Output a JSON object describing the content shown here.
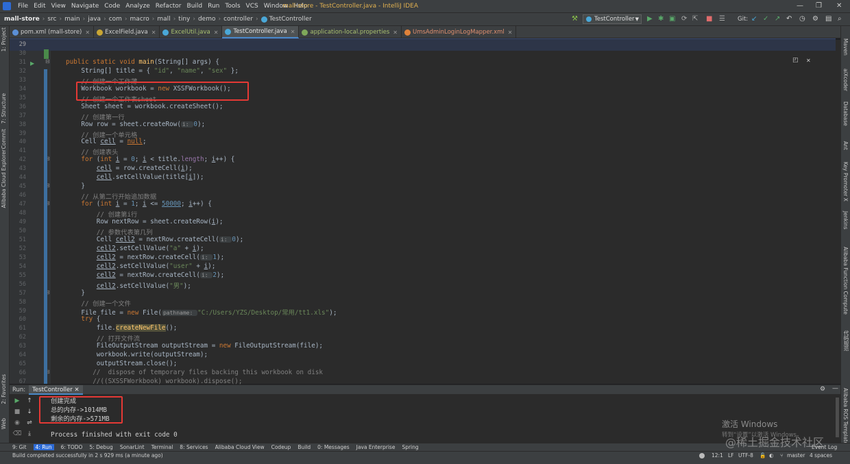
{
  "menubar": {
    "items": [
      "File",
      "Edit",
      "View",
      "Navigate",
      "Code",
      "Analyze",
      "Refactor",
      "Build",
      "Run",
      "Tools",
      "VCS",
      "Window",
      "Help"
    ],
    "window_title": "mall-store - TestController.java - IntelliJ IDEA"
  },
  "breadcrumb": [
    "mall-store",
    "src",
    "main",
    "java",
    "com",
    "macro",
    "mall",
    "tiny",
    "demo",
    "controller",
    "TestController"
  ],
  "toolbar": {
    "run_config": "TestController",
    "git_label": "Git:"
  },
  "tabs": [
    {
      "label": "pom.xml (mall-store)",
      "icon_color": "#5b8fd6"
    },
    {
      "label": "ExcelField.java",
      "icon_color": "#c9a634"
    },
    {
      "label": "ExcelUtil.java",
      "icon_color": "#4aa8d8"
    },
    {
      "label": "TestController.java",
      "icon_color": "#4aa8d8"
    },
    {
      "label": "application-local.properties",
      "icon_color": "#7fa85a"
    },
    {
      "label": "UmsAdminLoginLogMapper.xml",
      "icon_color": "#e0823a"
    }
  ],
  "left_strip": [
    "1: Project",
    "7: Structure",
    "Commit",
    "Alibaba Cloud Explorer",
    "2: Favorites",
    "Web"
  ],
  "right_strip": [
    "Maven",
    "aiXcoder",
    "Database",
    "Ant",
    "Key Promoter X",
    "Jenkins",
    "Alibaba Function Compute",
    "代码规范",
    "Alibaba ROS Templates"
  ],
  "editor": {
    "lines": [
      {
        "n": "29",
        "html": ""
      },
      {
        "n": "30",
        "html": ""
      },
      {
        "n": "31",
        "html": "<span class='kw'>public static void </span><span style='color:#ffc66d'>main</span>(String[] args) {"
      },
      {
        "n": "32",
        "html": "    String[] title = { <span class='str'>\"id\"</span>, <span class='str'>\"name\"</span>, <span class='str'>\"sex\"</span> };"
      },
      {
        "n": "33",
        "html": "    <span class='cm'>// 创建一个工作薄</span>"
      },
      {
        "n": "34",
        "html": "    Workbook workbook = <span class='kw'>new </span>XSSFWorkbook();"
      },
      {
        "n": "35",
        "html": "    <span class='cm'>// 创建一个工作表sheet</span>"
      },
      {
        "n": "36",
        "html": "    Sheet sheet = workbook.createSheet();"
      },
      {
        "n": "37",
        "html": "    <span class='cm'>// 创建第一行</span>"
      },
      {
        "n": "38",
        "html": "    Row row = sheet.createRow(<span class='hint'>i: </span><span class='num'>0</span>);"
      },
      {
        "n": "39",
        "html": "    <span class='cm'>// 创建一个单元格</span>"
      },
      {
        "n": "40",
        "html": "    Cell <span class='u'>cell</span> = <span class='kw u'>null</span>;"
      },
      {
        "n": "41",
        "html": "    <span class='cm'>// 创建表头</span>"
      },
      {
        "n": "42",
        "html": "    <span class='kw'>for </span>(<span class='kw'>int </span><span class='u'>i</span> = <span class='num'>0</span>; <span class='u'>i</span> &lt; title.<span class='fld'>length</span>; <span class='u'>i</span>++) {"
      },
      {
        "n": "43",
        "html": "        <span class='u'>cell</span> = row.createCell(<span class='u'>i</span>);"
      },
      {
        "n": "44",
        "html": "        <span class='u'>cell</span>.setCellValue(title[<span class='u'>i</span>]);"
      },
      {
        "n": "45",
        "html": "    }"
      },
      {
        "n": "46",
        "html": "    <span class='cm'>// 从第二行开始追加数据</span>"
      },
      {
        "n": "47",
        "html": "    <span class='kw'>for </span>(<span class='kw'>int </span><span class='u'>i</span> = <span class='num'>1</span>; <span class='u'>i</span> &lt;= <span class='num u'>50000</span>; <span class='u'>i</span>++) {"
      },
      {
        "n": "48",
        "html": "        <span class='cm'>// 创建第i行</span>"
      },
      {
        "n": "49",
        "html": "        Row nextRow = sheet.createRow(<span class='u'>i</span>);"
      },
      {
        "n": "50",
        "html": "        <span class='cm'>// 参数代表第几列</span>"
      },
      {
        "n": "51",
        "html": "        Cell <span class='u'>cell2</span> = nextRow.createCell(<span class='hint'>i: </span><span class='num'>0</span>);"
      },
      {
        "n": "52",
        "html": "        <span class='u'>cell2</span>.setCellValue(<span class='str'>\"a\"</span> + <span class='u'>i</span>);"
      },
      {
        "n": "53",
        "html": "        <span class='u'>cell2</span> = nextRow.createCell(<span class='hint'>i: </span><span class='num'>1</span>);"
      },
      {
        "n": "54",
        "html": "        <span class='u'>cell2</span>.setCellValue(<span class='str'>\"user\"</span> + <span class='u'>i</span>);"
      },
      {
        "n": "55",
        "html": "        <span class='u'>cell2</span> = nextRow.createCell(<span class='hint'>i: </span><span class='num'>2</span>);"
      },
      {
        "n": "56",
        "html": "        <span class='u'>cell2</span>.setCellValue(<span class='str'>\"男\"</span>);"
      },
      {
        "n": "57",
        "html": "    }"
      },
      {
        "n": "58",
        "html": "    <span class='cm'>// 创建一个文件</span>"
      },
      {
        "n": "59",
        "html": "    File file = <span class='kw'>new </span>File(<span class='hint'>pathname: </span><span class='str'>\"C:/Users/YZS/Desktop/常用/tt1.xls\"</span>);"
      },
      {
        "n": "60",
        "html": "    <span class='kw'>try </span>{"
      },
      {
        "n": "61",
        "html": "        file.<span class='hl'>createNewFile</span>();"
      },
      {
        "n": "62",
        "html": "        <span class='cm'>// 打开文件流</span>"
      },
      {
        "n": "63",
        "html": "        FileOutputStream outputStream = <span class='kw'>new </span>FileOutputStream(file);"
      },
      {
        "n": "64",
        "html": "        workbook.write(outputStream);"
      },
      {
        "n": "65",
        "html": "        outputStream.close();"
      },
      {
        "n": "66",
        "html": "       <span class='cm'>//  dispose of temporary files backing this workbook on disk</span>"
      },
      {
        "n": "67",
        "html": "       <span class='cm'>//((SXSSFWorkbook) workbook).dispose();</span>"
      }
    ]
  },
  "run": {
    "label": "Run:",
    "tab": "TestController",
    "output": [
      "创建完成",
      "总的内存->1014MB",
      "剩余的内存->571MB",
      "",
      "Process finished with exit code 0"
    ]
  },
  "tool_windows": [
    "9: Git",
    "4: Run",
    "6: TODO",
    "5: Debug",
    "SonarLint",
    "Terminal",
    "8: Services",
    "Alibaba Cloud View",
    "Codeup",
    "Build",
    "0: Messages",
    "Java Enterprise",
    "Spring"
  ],
  "event_log": "Event Log",
  "status": {
    "message": "Build completed successfully in 2 s 929 ms (a minute ago)",
    "position": "12:1",
    "line_sep": "LF",
    "encoding": "UTF-8",
    "branch": "master",
    "indent": "4 spaces"
  },
  "watermark": {
    "activate": "激活 Windows",
    "activate_sub": "转到“设置”以激活 Windows。",
    "site": "@稀土掘金技术社区"
  }
}
